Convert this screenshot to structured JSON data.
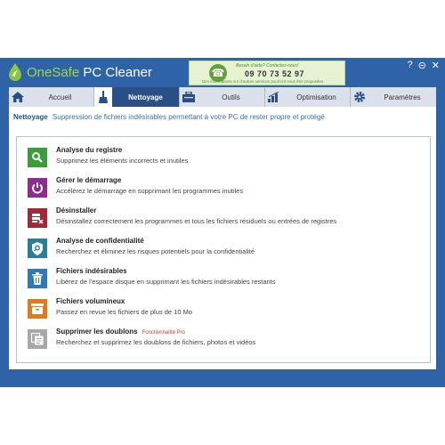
{
  "app": {
    "title_prefix": "OneSafe",
    "title_name": "PC Cleaner"
  },
  "support": {
    "help_text": "Besoin d'aide? Contactez-nous!",
    "phone": "09 70 73 52 97",
    "note": "Des informations sur d'autres services pourront vous être proposées",
    "icon": "phone-icon"
  },
  "window_controls": {
    "help": "?",
    "minimize": "⊝",
    "close": "✕"
  },
  "tabs": [
    {
      "label": "Accueil",
      "icon": "home-icon"
    },
    {
      "label": "Nettoyage",
      "icon": "broom-icon"
    },
    {
      "label": "Outils",
      "icon": "toolbox-icon"
    },
    {
      "label": "Optimisation",
      "icon": "bar-chart-icon"
    },
    {
      "label": "Paramètres",
      "icon": "gear-icon"
    }
  ],
  "active_tab": "Nettoyage",
  "subheader": {
    "title": "Nettoyage",
    "description": "Suppression de fichiers indésirables permettant à votre PC de rester propre et protégé"
  },
  "items": [
    {
      "title": "Analyse du registre",
      "desc": "Supprimez les éléments incorrects et inutiles",
      "icon": "search-icon",
      "color": "#3a9d3a"
    },
    {
      "title": "Gérer le démarrage",
      "desc": "Accélérez le démarrage en supprimant les programmes inutiles",
      "icon": "power-icon",
      "color": "#8e2b8e"
    },
    {
      "title": "Désinstaller",
      "desc": "Désinstallez correctement les programmes et tous les fichiers résiduels ou entrées de registres",
      "icon": "uninstall-icon",
      "color": "#a3273b"
    },
    {
      "title": "Analyse de confidentialité",
      "desc": "Recherchez et éliminez les risques potentiels pour la confidentialité",
      "icon": "privacy-shield-icon",
      "color": "#2a7f96"
    },
    {
      "title": "Fichiers indésirables",
      "desc": "Libérez de l'espace disque en supprimant les fichiers indésirables restants",
      "icon": "trash-icon",
      "color": "#2f79b5"
    },
    {
      "title": "Fichiers volumineux",
      "desc": "Passez en revue les fichiers de plus de 10 Mo",
      "icon": "large-file-icon",
      "color": "#e07a1f"
    },
    {
      "title": "Supprimer les doublons",
      "desc": "Recherchez et supprimez les doublons de fichiers, photos et vidéos",
      "icon": "duplicate-icon",
      "color": "#a8a8a8",
      "badge": "Fonctionnalité Pro"
    }
  ]
}
